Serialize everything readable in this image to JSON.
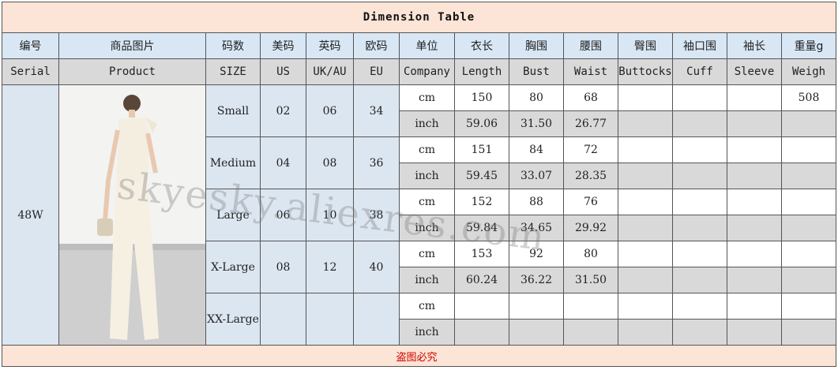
{
  "title": "Dimension Table",
  "headers_cn": [
    "编号",
    "商品图片",
    "码数",
    "美码",
    "英码",
    "欧码",
    "单位",
    "衣长",
    "胸围",
    "腰围",
    "臀围",
    "袖口围",
    "袖长",
    "重量g"
  ],
  "headers_en": [
    "Serial",
    "Product",
    "SIZE",
    "US",
    "UK/AU",
    "EU",
    "Company",
    "Length",
    "Bust",
    "Waist",
    "Buttocks",
    "Cuff",
    "Sleeve",
    "Weigh"
  ],
  "serial": "48W",
  "sizes": [
    {
      "name": "Small",
      "us": "02",
      "uk": "06",
      "eu": "34",
      "cm": {
        "unit": "cm",
        "length": "150",
        "bust": "80",
        "waist": "68",
        "buttocks": "",
        "cuff": "",
        "sleeve": "",
        "weight": "508"
      },
      "inch": {
        "unit": "inch",
        "length": "59.06",
        "bust": "31.50",
        "waist": "26.77",
        "buttocks": "",
        "cuff": "",
        "sleeve": "",
        "weight": ""
      }
    },
    {
      "name": "Medium",
      "us": "04",
      "uk": "08",
      "eu": "36",
      "cm": {
        "unit": "cm",
        "length": "151",
        "bust": "84",
        "waist": "72",
        "buttocks": "",
        "cuff": "",
        "sleeve": "",
        "weight": ""
      },
      "inch": {
        "unit": "inch",
        "length": "59.45",
        "bust": "33.07",
        "waist": "28.35",
        "buttocks": "",
        "cuff": "",
        "sleeve": "",
        "weight": ""
      }
    },
    {
      "name": "Large",
      "us": "06",
      "uk": "10",
      "eu": "38",
      "cm": {
        "unit": "cm",
        "length": "152",
        "bust": "88",
        "waist": "76",
        "buttocks": "",
        "cuff": "",
        "sleeve": "",
        "weight": ""
      },
      "inch": {
        "unit": "inch",
        "length": "59.84",
        "bust": "34.65",
        "waist": "29.92",
        "buttocks": "",
        "cuff": "",
        "sleeve": "",
        "weight": ""
      }
    },
    {
      "name": "X-Large",
      "us": "08",
      "uk": "12",
      "eu": "40",
      "cm": {
        "unit": "cm",
        "length": "153",
        "bust": "92",
        "waist": "80",
        "buttocks": "",
        "cuff": "",
        "sleeve": "",
        "weight": ""
      },
      "inch": {
        "unit": "inch",
        "length": "60.24",
        "bust": "36.22",
        "waist": "31.50",
        "buttocks": "",
        "cuff": "",
        "sleeve": "",
        "weight": ""
      }
    },
    {
      "name": "XX-Large",
      "us": "",
      "uk": "",
      "eu": "",
      "cm": {
        "unit": "cm",
        "length": "",
        "bust": "",
        "waist": "",
        "buttocks": "",
        "cuff": "",
        "sleeve": "",
        "weight": ""
      },
      "inch": {
        "unit": "inch",
        "length": "",
        "bust": "",
        "waist": "",
        "buttocks": "",
        "cuff": "",
        "sleeve": "",
        "weight": ""
      }
    }
  ],
  "watermark": "skyesky.aliexres.com",
  "footer": "盗图必究",
  "colors": {
    "title_bg": "#fce4d6",
    "cn_header_bg": "#d9e7f5",
    "en_header_bg": "#d9d9d9",
    "blue_cell": "#dce6f1",
    "grey_cell": "#d9d9d9",
    "footer_text": "#d00000"
  }
}
